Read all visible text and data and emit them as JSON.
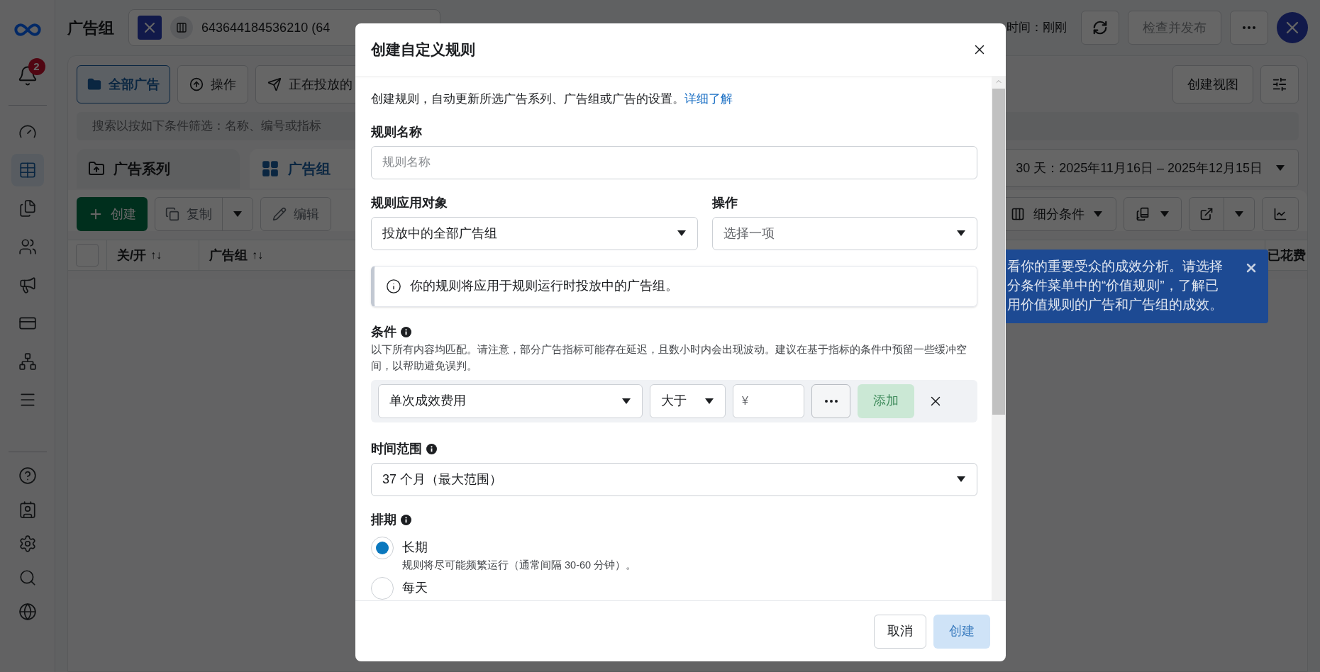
{
  "sidebar": {
    "notification_count": "2",
    "items": [
      {
        "kind": "gauge",
        "selected": false
      },
      {
        "kind": "table",
        "selected": true
      },
      {
        "kind": "pages",
        "selected": false
      },
      {
        "kind": "people",
        "selected": false
      },
      {
        "kind": "megaphone",
        "selected": false
      },
      {
        "kind": "card",
        "selected": false
      },
      {
        "kind": "network",
        "selected": false
      },
      {
        "kind": "menu",
        "selected": false
      }
    ],
    "bottom_items": [
      {
        "kind": "help",
        "selected": false
      },
      {
        "kind": "contact",
        "selected": false
      },
      {
        "kind": "settings",
        "selected": false
      },
      {
        "kind": "search",
        "selected": false
      },
      {
        "kind": "globe",
        "selected": false
      }
    ]
  },
  "top_bar": {
    "title": "广告组",
    "account_id": "643644184536210 (64",
    "updated": "时间：刚刚",
    "publish_button": "检查并发布"
  },
  "toolbar": {
    "all_ads": "全部广告",
    "actions": "操作",
    "delivering": "正在投放的",
    "create_view": "创建视图"
  },
  "search": {
    "placeholder": "搜索以按如下条件筛选：名称、编号或指标"
  },
  "level_tabs": [
    {
      "label": "广告系列",
      "selected": false
    },
    {
      "label": "广告组",
      "selected": true
    }
  ],
  "date_range": "30 天：2025年11月16日 – 2025年12月15日",
  "table_toolbar": {
    "create": "创建",
    "duplicate": "复制",
    "edit": "编辑",
    "breakdown": "细分条件"
  },
  "table": {
    "select_all": {
      "checked": false
    },
    "columns": [
      {
        "label": "关/开",
        "sort_icon": "↑↓"
      },
      {
        "label": "广告组",
        "sort_icon": "↑↓"
      },
      {
        "label": "已花费"
      }
    ]
  },
  "tip": {
    "lines": [
      "看你的重要受众的成效分析。请选择",
      "分条件菜单中的“价值规则”，了解已",
      "用价值规则的广告和广告组的成效。"
    ]
  },
  "dialog": {
    "title": "创建自定义规则",
    "intro": "创建规则，自动更新所选广告系列、广告组或广告的设置。",
    "learn_more": "详细了解",
    "rule_name": {
      "label": "规则名称",
      "placeholder": "规则名称"
    },
    "apply_to": {
      "label": "规则应用对象",
      "value": "投放中的全部广告组"
    },
    "action": {
      "label": "操作",
      "placeholder": "选择一项"
    },
    "notice": "你的规则将应用于规则运行时投放中的广告组。",
    "conditions": {
      "label": "条件",
      "description": "以下所有内容均匹配。请注意，部分广告指标可能存在延迟，且数小时内会出现波动。建议在基于指标的条件中预留一些缓冲空间，以帮助避免误判。",
      "metric": "单次成效费用",
      "operator": "大于",
      "currency": "¥",
      "add_button": {
        "label": "添加",
        "disabled": true
      }
    },
    "time_range": {
      "label": "时间范围",
      "value": "37 个月（最大范围）"
    },
    "schedule": {
      "label": "排期",
      "options": [
        {
          "label": "长期",
          "description": "规则将尽可能频繁运行（通常间隔 30-60 分钟）。",
          "selected": true
        },
        {
          "label": "每天",
          "selected": false
        }
      ]
    },
    "cancel_button": "取消",
    "create_button": {
      "label": "创建",
      "disabled": true
    }
  }
}
